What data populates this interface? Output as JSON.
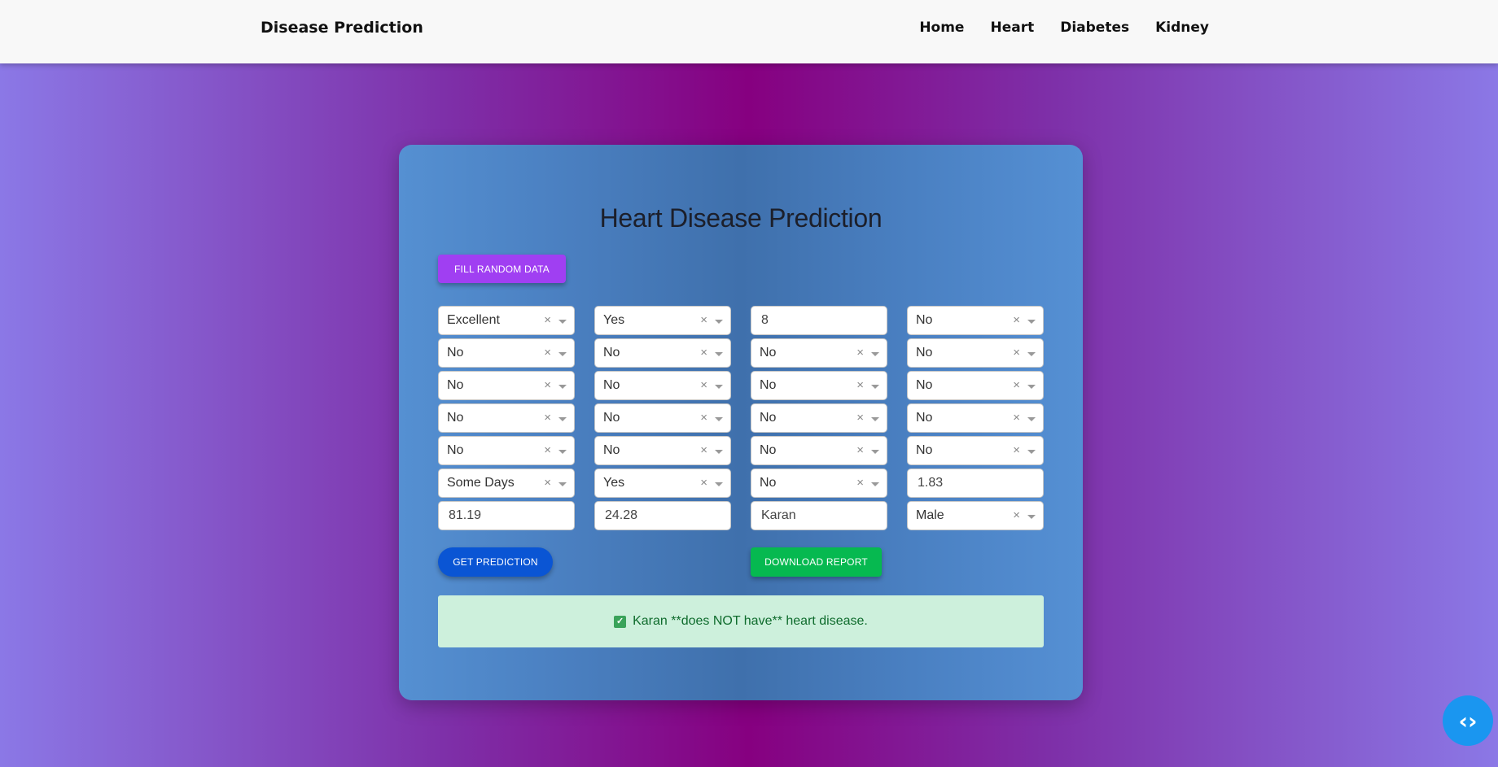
{
  "navbar": {
    "brand": "Disease Prediction",
    "links": [
      "Home",
      "Heart",
      "Diabetes",
      "Kidney"
    ]
  },
  "card": {
    "title": "Heart Disease Prediction",
    "fill_random_label": "FILL RANDOM DATA",
    "predict_label": "GET PREDICTION",
    "download_label": "DOWNLOAD REPORT",
    "result_icon": "check-icon",
    "result_text": "Karan **does NOT have** heart disease."
  },
  "fields": [
    {
      "kind": "select",
      "value": "Excellent"
    },
    {
      "kind": "select",
      "value": "Yes"
    },
    {
      "kind": "input",
      "value": "8"
    },
    {
      "kind": "select",
      "value": "No"
    },
    {
      "kind": "select",
      "value": "No"
    },
    {
      "kind": "select",
      "value": "No"
    },
    {
      "kind": "select",
      "value": "No"
    },
    {
      "kind": "select",
      "value": "No"
    },
    {
      "kind": "select",
      "value": "No"
    },
    {
      "kind": "select",
      "value": "No"
    },
    {
      "kind": "select",
      "value": "No"
    },
    {
      "kind": "select",
      "value": "No"
    },
    {
      "kind": "select",
      "value": "No"
    },
    {
      "kind": "select",
      "value": "No"
    },
    {
      "kind": "select",
      "value": "No"
    },
    {
      "kind": "select",
      "value": "No"
    },
    {
      "kind": "select",
      "value": "No"
    },
    {
      "kind": "select",
      "value": "No"
    },
    {
      "kind": "select",
      "value": "No"
    },
    {
      "kind": "select",
      "value": "No"
    },
    {
      "kind": "select",
      "value": "Some Days"
    },
    {
      "kind": "select",
      "value": "Yes"
    },
    {
      "kind": "select",
      "value": "No"
    },
    {
      "kind": "input",
      "value": "1.83"
    },
    {
      "kind": "input",
      "value": "81.19"
    },
    {
      "kind": "input",
      "value": "24.28"
    },
    {
      "kind": "input",
      "value": "Karan"
    },
    {
      "kind": "select",
      "value": "Male"
    }
  ],
  "floating": {
    "code_icon": "code-icon",
    "glyph": "‹›"
  },
  "colors": {
    "fill_random": "#a03ff2",
    "predict": "#0a55d4",
    "download": "#06b950",
    "result_bg": "#cdf0dc",
    "result_text": "#0e6b2c"
  }
}
